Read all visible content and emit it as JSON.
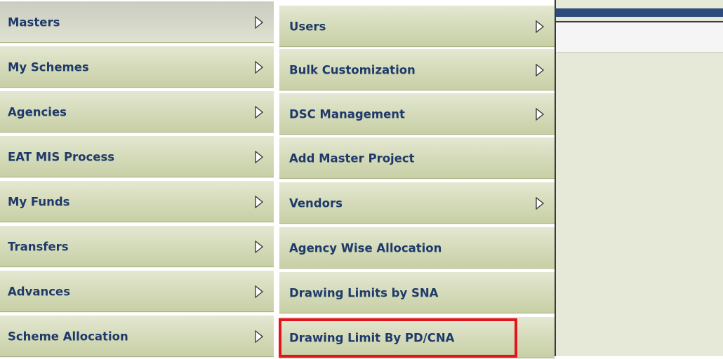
{
  "primary_menu": {
    "items": [
      {
        "label": "Masters",
        "active": true
      },
      {
        "label": "My Schemes"
      },
      {
        "label": "Agencies"
      },
      {
        "label": "EAT MIS Process"
      },
      {
        "label": "My Funds"
      },
      {
        "label": "Transfers"
      },
      {
        "label": "Advances"
      },
      {
        "label": "Scheme Allocation"
      }
    ]
  },
  "sub_menu": {
    "items": [
      {
        "label": "Users",
        "has_submenu": true
      },
      {
        "label": "Bulk Customization",
        "has_submenu": true
      },
      {
        "label": "DSC Management",
        "has_submenu": true
      },
      {
        "label": "Add Master Project",
        "has_submenu": false
      },
      {
        "label": "Vendors",
        "has_submenu": true
      },
      {
        "label": "Agency Wise Allocation",
        "has_submenu": false
      },
      {
        "label": "Drawing Limits by SNA",
        "has_submenu": false
      },
      {
        "label": "Drawing Limit By PD/CNA",
        "has_submenu": false,
        "highlighted": true
      }
    ]
  },
  "icons": {
    "submenu_arrow": "chevron-right-icon"
  },
  "colors": {
    "menu_text": "#1f3a6a",
    "highlight": "#e2141c",
    "header_bar": "#2d4b7c",
    "panel_bg": "#e6e8d8"
  }
}
